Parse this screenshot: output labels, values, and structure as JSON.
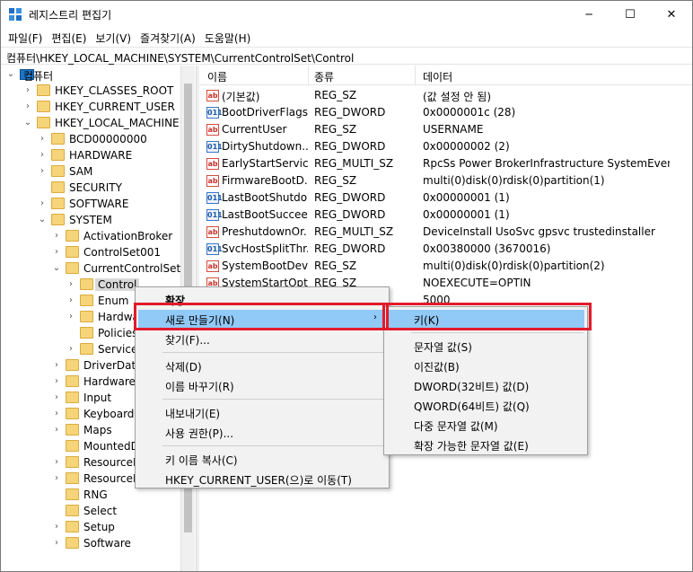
{
  "window": {
    "title": "레지스트리 편집기",
    "minimize_glyph": "─",
    "maximize_glyph": "☐",
    "close_glyph": "✕"
  },
  "menu": [
    "파일(F)",
    "편집(E)",
    "보기(V)",
    "즐겨찾기(A)",
    "도움말(H)"
  ],
  "address": "컴퓨터\\HKEY_LOCAL_MACHINE\\SYSTEM\\CurrentControlSet\\Control",
  "tree": [
    {
      "label": "컴퓨터",
      "expander": "⌄",
      "icon": "computer-icon"
    },
    {
      "label": "HKEY_CLASSES_ROOT",
      "expander": "›",
      "icon": "folder-icon"
    },
    {
      "label": "HKEY_CURRENT_USER",
      "expander": "›",
      "icon": "folder-icon"
    },
    {
      "label": "HKEY_LOCAL_MACHINE",
      "expander": "⌄",
      "icon": "folder-icon"
    },
    {
      "label": "BCD00000000",
      "expander": "›",
      "icon": "folder-icon"
    },
    {
      "label": "HARDWARE",
      "expander": "›",
      "icon": "folder-icon"
    },
    {
      "label": "SAM",
      "expander": "›",
      "icon": "folder-icon"
    },
    {
      "label": "SECURITY",
      "expander": "",
      "icon": "folder-icon"
    },
    {
      "label": "SOFTWARE",
      "expander": "›",
      "icon": "folder-icon"
    },
    {
      "label": "SYSTEM",
      "expander": "⌄",
      "icon": "folder-icon"
    },
    {
      "label": "ActivationBroker",
      "expander": "›",
      "icon": "folder-icon"
    },
    {
      "label": "ControlSet001",
      "expander": "›",
      "icon": "folder-icon"
    },
    {
      "label": "CurrentControlSet",
      "expander": "⌄",
      "icon": "folder-icon"
    },
    {
      "label": "Control",
      "expander": "›",
      "icon": "folder-icon",
      "selected": true
    },
    {
      "label": "Enum",
      "expander": "›",
      "icon": "folder-icon"
    },
    {
      "label": "Hardwa",
      "expander": "›",
      "icon": "folder-icon"
    },
    {
      "label": "Policies",
      "expander": "",
      "icon": "folder-icon"
    },
    {
      "label": "Services",
      "expander": "›",
      "icon": "folder-icon"
    },
    {
      "label": "DriverDatal",
      "expander": "›",
      "icon": "folder-icon"
    },
    {
      "label": "HardwareC",
      "expander": "›",
      "icon": "folder-icon"
    },
    {
      "label": "Input",
      "expander": "›",
      "icon": "folder-icon"
    },
    {
      "label": "Keyboard L",
      "expander": "›",
      "icon": "folder-icon"
    },
    {
      "label": "Maps",
      "expander": "›",
      "icon": "folder-icon"
    },
    {
      "label": "MountedD",
      "expander": "",
      "icon": "folder-icon"
    },
    {
      "label": "ResourceM",
      "expander": "›",
      "icon": "folder-icon"
    },
    {
      "label": "ResourcePo",
      "expander": "›",
      "icon": "folder-icon"
    },
    {
      "label": "RNG",
      "expander": "",
      "icon": "folder-icon"
    },
    {
      "label": "Select",
      "expander": "",
      "icon": "folder-icon"
    },
    {
      "label": "Setup",
      "expander": "›",
      "icon": "folder-icon"
    },
    {
      "label": "Software",
      "expander": "›",
      "icon": "folder-icon"
    }
  ],
  "columns": {
    "name": "이름",
    "type": "종류",
    "data": "데이터"
  },
  "values": [
    {
      "icon": "ab",
      "name": "(기본값)",
      "type": "REG_SZ",
      "data": "(값 설정 안 됨)"
    },
    {
      "icon": "bin",
      "name": "BootDriverFlags",
      "type": "REG_DWORD",
      "data": "0x0000001c (28)"
    },
    {
      "icon": "ab",
      "name": "CurrentUser",
      "type": "REG_SZ",
      "data": "USERNAME"
    },
    {
      "icon": "bin",
      "name": "DirtyShutdown...",
      "type": "REG_DWORD",
      "data": "0x00000002 (2)"
    },
    {
      "icon": "ab",
      "name": "EarlyStartServices",
      "type": "REG_MULTI_SZ",
      "data": "RpcSs Power BrokerInfrastructure SystemEventsBr..."
    },
    {
      "icon": "ab",
      "name": "FirmwareBootD...",
      "type": "REG_SZ",
      "data": "multi(0)disk(0)rdisk(0)partition(1)"
    },
    {
      "icon": "bin",
      "name": "LastBootShutdo...",
      "type": "REG_DWORD",
      "data": "0x00000001 (1)"
    },
    {
      "icon": "bin",
      "name": "LastBootSuccee...",
      "type": "REG_DWORD",
      "data": "0x00000001 (1)"
    },
    {
      "icon": "ab",
      "name": "PreshutdownOr...",
      "type": "REG_MULTI_SZ",
      "data": "DeviceInstall UsoSvc gpsvc trustedinstaller"
    },
    {
      "icon": "bin",
      "name": "SvcHostSplitThr...",
      "type": "REG_DWORD",
      "data": "0x00380000 (3670016)"
    },
    {
      "icon": "ab",
      "name": "SystemBootDev...",
      "type": "REG_SZ",
      "data": "multi(0)disk(0)rdisk(0)partition(2)"
    },
    {
      "icon": "ab",
      "name": "SystemStartOpti...",
      "type": "REG_SZ",
      "data": "NOEXECUTE=OPTIN"
    },
    {
      "icon": "bin",
      "name": "",
      "type": "",
      "data": "5000"
    }
  ],
  "context_menu": {
    "items": [
      {
        "label": "확장",
        "bold": true
      },
      {
        "label": "새로 만들기(N)",
        "submenu": true,
        "highlighted": true
      },
      {
        "label": "찾기(F)..."
      },
      {
        "separator": true
      },
      {
        "label": "삭제(D)"
      },
      {
        "label": "이름 바꾸기(R)"
      },
      {
        "separator": true
      },
      {
        "label": "내보내기(E)"
      },
      {
        "label": "사용 권한(P)..."
      },
      {
        "separator": true
      },
      {
        "label": "키 이름 복사(C)"
      },
      {
        "label": "HKEY_CURRENT_USER(으)로 이동(T)"
      }
    ],
    "submenu_arrow": "›"
  },
  "submenu": {
    "items": [
      {
        "label": "키(K)",
        "highlighted": true
      },
      {
        "separator": true
      },
      {
        "label": "문자열 값(S)"
      },
      {
        "label": "이진값(B)"
      },
      {
        "label": "DWORD(32비트) 값(D)"
      },
      {
        "label": "QWORD(64비트) 값(Q)"
      },
      {
        "label": "다중 문자열 값(M)"
      },
      {
        "label": "확장 가능한 문자열 값(E)"
      }
    ]
  },
  "colors": {
    "highlight": "#91c9f7",
    "annotation_box": "#e21b2b",
    "folder": "#f6d47a"
  }
}
